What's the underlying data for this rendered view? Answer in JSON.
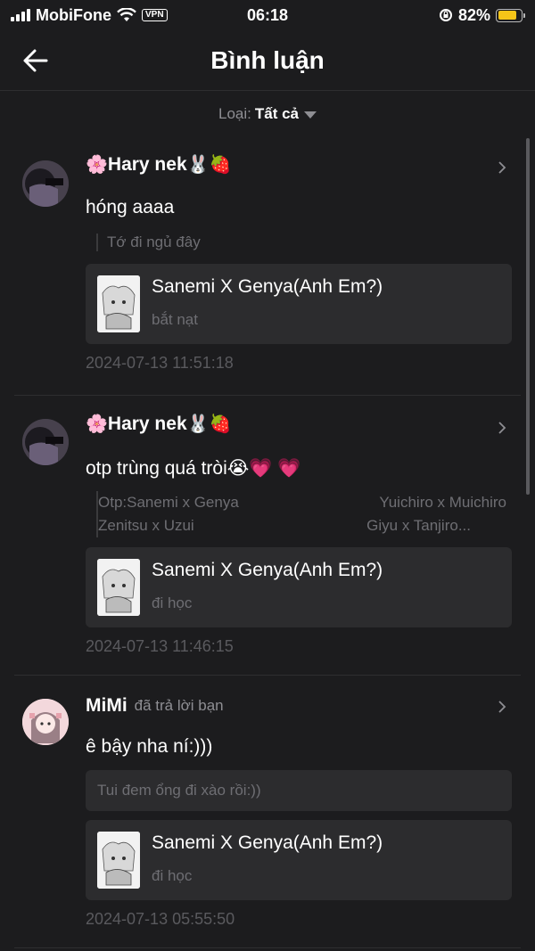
{
  "status_bar": {
    "carrier": "MobiFone",
    "vpn": "VPN",
    "time": "06:18",
    "battery": "82%",
    "battery_level": 0.82,
    "battery_color": "#f5c518"
  },
  "header": {
    "title": "Bình luận",
    "back_icon": "arrow-left-icon"
  },
  "filter": {
    "label": "Loại:",
    "value": "Tất cả"
  },
  "comments": [
    {
      "username": "Hary nek",
      "emojis_before": "🌸",
      "emojis_after": "🐰🍓",
      "text": "hóng aaaa",
      "quote": "Tớ đi ngủ đây",
      "story": {
        "title": "Sanemi X Genya(Anh Em?)",
        "chapter": "bắt nạt"
      },
      "timestamp": "2024-07-13 11:51:18"
    },
    {
      "username": "Hary nek",
      "emojis_before": "🌸",
      "emojis_after": "🐰🍓",
      "text": "otp trùng quá tròi😭💗 💗",
      "quote_lines": [
        [
          "Otp:Sanemi x Genya",
          "Yuichiro x Muichiro"
        ],
        [
          "Zenitsu x Uzui",
          "Giyu x Tanjiro..."
        ]
      ],
      "story": {
        "title": "Sanemi X Genya(Anh Em?)",
        "chapter": "đi học"
      },
      "timestamp": "2024-07-13 11:46:15"
    },
    {
      "username": "MiMi",
      "reply_note": "đã trả lời bạn",
      "text": "ê bậy nha ní:)))",
      "reply_box": "Tui đem ổng đi xào rồi:))",
      "story": {
        "title": "Sanemi X Genya(Anh Em?)",
        "chapter": "đi học"
      },
      "timestamp": "2024-07-13 05:55:50"
    }
  ],
  "colors": {
    "background": "#1c1c1e",
    "card": "#2c2c2e",
    "muted": "#8e8e93"
  }
}
